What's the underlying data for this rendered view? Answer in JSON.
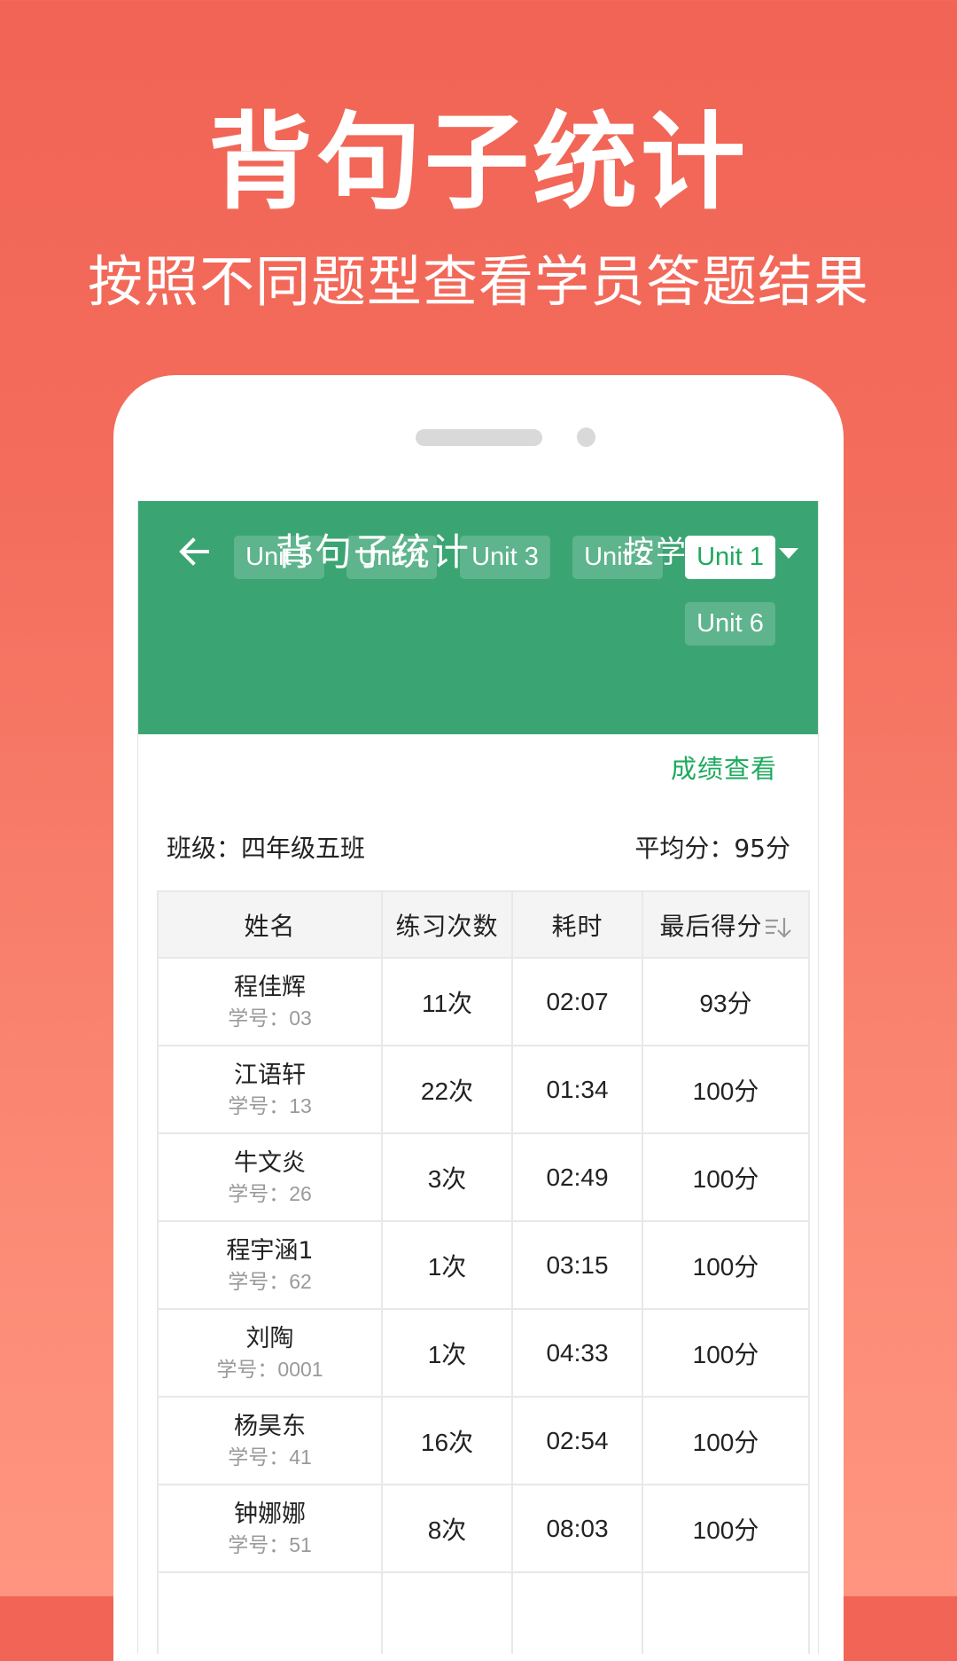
{
  "hero": {
    "title": "背句子统计",
    "subtitle": "按照不同题型查看学员答题结果"
  },
  "appbar": {
    "back_icon": "arrow-left-icon",
    "title": "背句子统计",
    "mode_selected": "按学生",
    "mode_caret_icon": "caret-down-icon"
  },
  "units": [
    {
      "label": "Unit 5",
      "active": false
    },
    {
      "label": "Unit 4",
      "active": false
    },
    {
      "label": "Unit 3",
      "active": false
    },
    {
      "label": "Unit 2",
      "active": false
    },
    {
      "label": "Unit 1",
      "active": true
    },
    {
      "label": "Unit 6",
      "active": false
    }
  ],
  "score_link": "成绩查看",
  "class_info": "班级：四年级五班",
  "avg_info": "平均分：95分",
  "table": {
    "headers": [
      "姓名",
      "练习次数",
      "耗时",
      "最后得分"
    ],
    "sort_icon": "sort-descending-icon",
    "rows": [
      {
        "name": "程佳辉",
        "sid": "学号：03",
        "count": "11次",
        "time": "02:07",
        "score": "93分"
      },
      {
        "name": "江语轩",
        "sid": "学号：13",
        "count": "22次",
        "time": "01:34",
        "score": "100分"
      },
      {
        "name": "牛文炎",
        "sid": "学号：26",
        "count": "3次",
        "time": "02:49",
        "score": "100分"
      },
      {
        "name": "程宇涵1",
        "sid": "学号：62",
        "count": "1次",
        "time": "03:15",
        "score": "100分"
      },
      {
        "name": "刘陶",
        "sid": "学号：0001",
        "count": "1次",
        "time": "04:33",
        "score": "100分"
      },
      {
        "name": "杨昊东",
        "sid": "学号：41",
        "count": "16次",
        "time": "02:54",
        "score": "100分"
      },
      {
        "name": "钟娜娜",
        "sid": "学号：51",
        "count": "8次",
        "time": "08:03",
        "score": "100分"
      }
    ]
  },
  "colors": {
    "accent_green": "#3BA473",
    "link_green": "#1DAA5E",
    "background_top": "#F26455",
    "background_bottom": "#FF9580"
  }
}
